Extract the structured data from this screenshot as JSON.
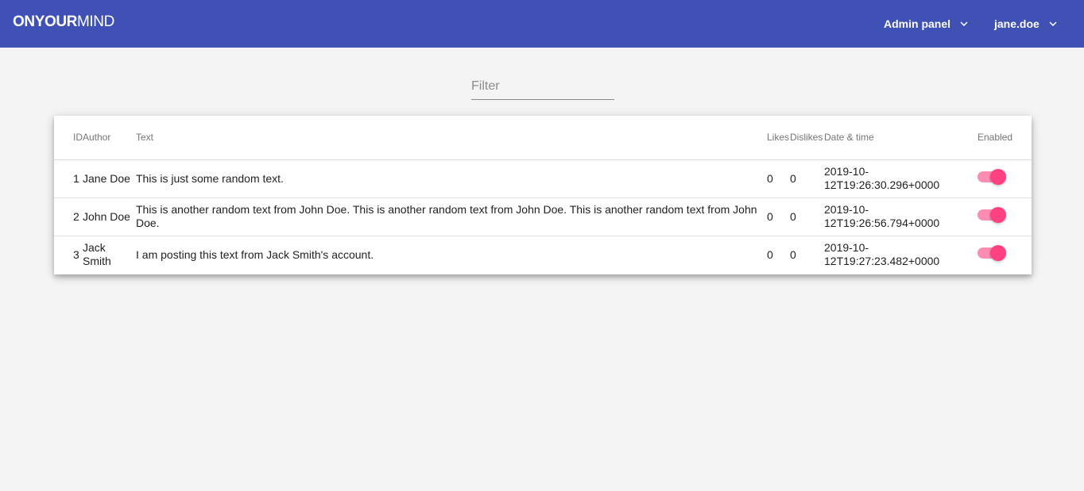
{
  "app": {
    "brand_part1": "ON",
    "brand_part2": "YOUR",
    "brand_part3": "MIND",
    "nav": {
      "admin_label": "Admin panel",
      "user_label": "jane.doe"
    }
  },
  "colors": {
    "toolbar": "#3f51b5",
    "toggle_thumb": "#ff4081",
    "toggle_track": "#fd8cb2",
    "background": "#f4f4f4"
  },
  "icons": {
    "admin_dropdown": "chevron-down-icon",
    "user_dropdown": "chevron-down-icon"
  },
  "filter": {
    "placeholder": "Filter",
    "value": ""
  },
  "table": {
    "headers": {
      "id": "ID",
      "author": "Author",
      "text": "Text",
      "likes": "Likes",
      "dislikes": "Dislikes",
      "date": "Date & time",
      "enabled": "Enabled"
    },
    "rows": [
      {
        "id": "1",
        "author": "Jane Doe",
        "text": "This is just some random text.",
        "likes": "0",
        "dislikes": "0",
        "date": "2019-10-12T19:26:30.296+0000",
        "enabled": true
      },
      {
        "id": "2",
        "author": "John Doe",
        "text": "This is another random text from John Doe. This is another random text from John Doe. This is another random text from John Doe.",
        "likes": "0",
        "dislikes": "0",
        "date": "2019-10-12T19:26:56.794+0000",
        "enabled": true
      },
      {
        "id": "3",
        "author": "Jack Smith",
        "text": "I am posting this text from Jack Smith's account.",
        "likes": "0",
        "dislikes": "0",
        "date": "2019-10-12T19:27:23.482+0000",
        "enabled": true
      }
    ]
  }
}
